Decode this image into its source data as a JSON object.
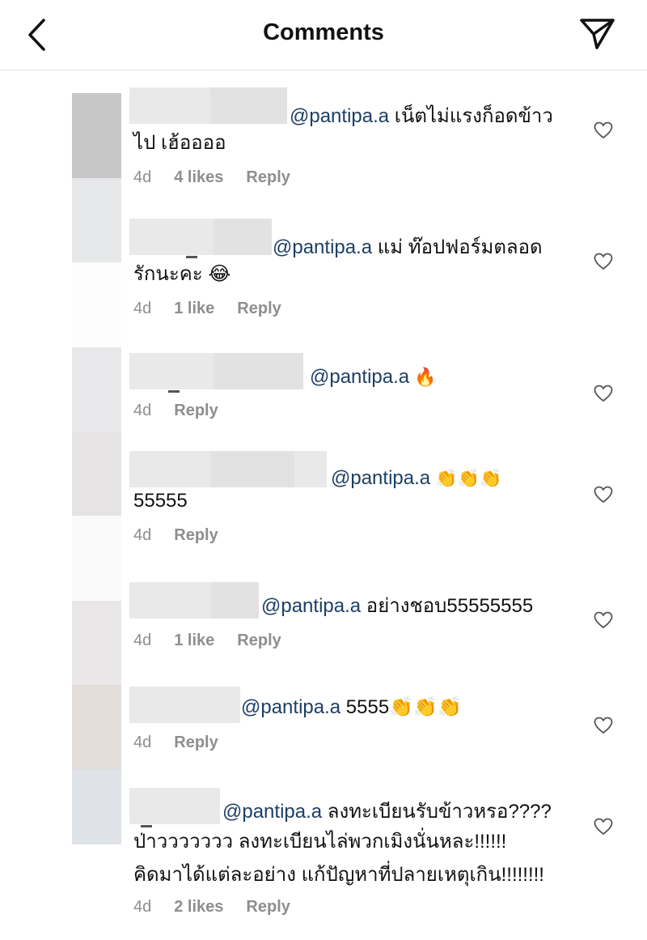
{
  "header": {
    "title": "Comments"
  },
  "icons": {
    "back": "chevron-left-icon",
    "send": "paper-plane-icon",
    "like": "heart-icon"
  },
  "stripe_colors": [
    "#c7c7c7",
    "#e7e8ea",
    "#fdfdfd",
    "#e9e9eb",
    "#e6e3e4",
    "#fafafa",
    "#e9e7e7",
    "#e2ddd9",
    "#dfe3e7"
  ],
  "comments": [
    {
      "mention": "@pantipa.a",
      "line1": " เน็ตไม่แรงก็อดข้าว",
      "line2": "ไป เฮ้ออออ",
      "time": "4d",
      "likes": "4 likes",
      "reply": "Reply"
    },
    {
      "mention": "@pantipa.a",
      "line1": " แม่ ท๊อปฟอร์มตลอด",
      "line2": "รักนะคะ 😂",
      "time": "4d",
      "likes": "1 like",
      "reply": "Reply"
    },
    {
      "mention": "@pantipa.a",
      "line1": " 🔥",
      "time": "4d",
      "reply": "Reply"
    },
    {
      "mention": "@pantipa.a",
      "line1": " 👏👏👏",
      "line2": "55555",
      "time": "4d",
      "reply": "Reply"
    },
    {
      "mention": "@pantipa.a",
      "line1": " อย่างชอบ55555555",
      "time": "4d",
      "likes": "1 like",
      "reply": "Reply"
    },
    {
      "mention": "@pantipa.a",
      "line1": " 5555👏👏👏",
      "time": "4d",
      "reply": "Reply"
    },
    {
      "mention": "@pantipa.a",
      "line1": " ลงทะเบียนรับข้าวหรอ????",
      "line2": "ป่าววววววว ลงทะเบียนไล่พวกเมิงนั่นหละ!!!!!!",
      "line3": "คิดมาได้แต่ละอย่าง แก้ปัญหาที่ปลายเหตุเกิน!!!!!!!!",
      "time": "4d",
      "likes": "2 likes",
      "reply": "Reply"
    }
  ]
}
